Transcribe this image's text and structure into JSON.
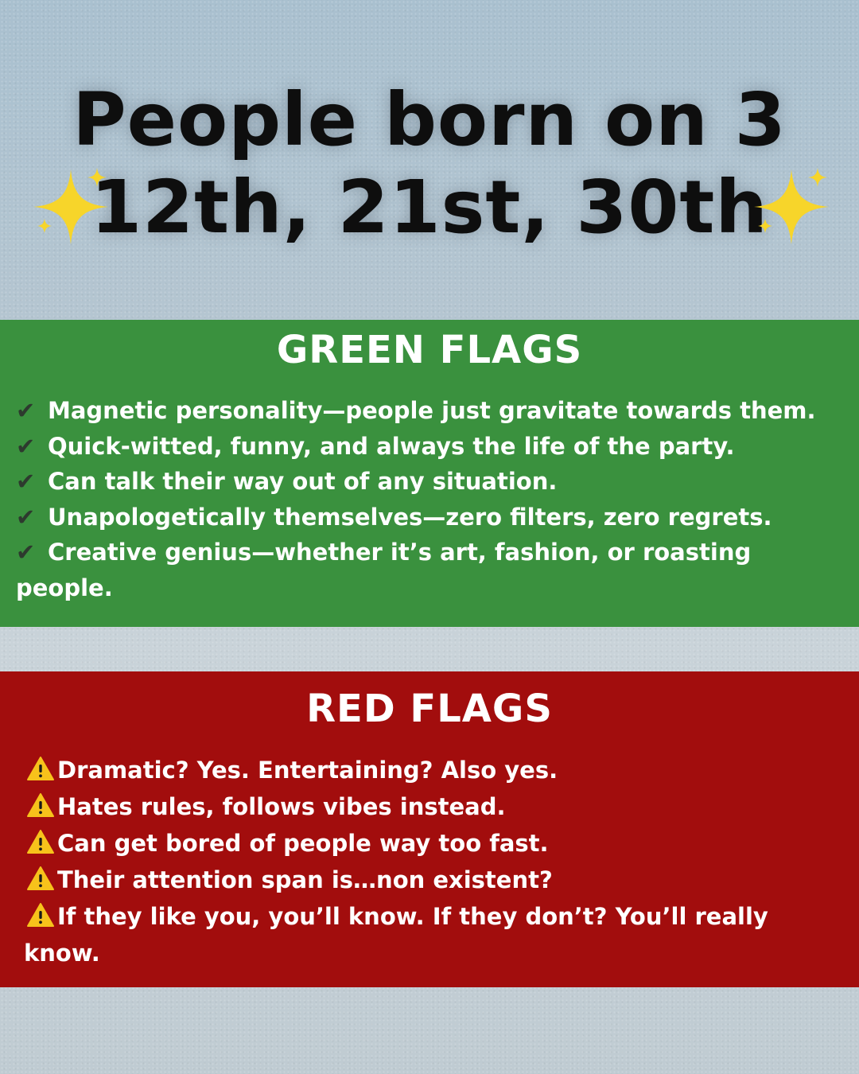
{
  "title": {
    "line1": "People born on 3",
    "line2": "12th, 21st, 30th"
  },
  "decorations": {
    "sparkle_icon": "sparkles-icon",
    "sparkle_color": "#f7d52a"
  },
  "green_flags": {
    "heading": "GREEN FLAGS",
    "bullet": "✔",
    "color": "#3a913e",
    "items": [
      "Magnetic personality—people just gravitate towards them.",
      "Quick-witted, funny, and always the life of the party.",
      "Can talk their way out of any situation.",
      "Unapologetically themselves—zero filters, zero regrets.",
      "Creative genius—whether it’s art, fashion, or roasting people."
    ]
  },
  "red_flags": {
    "heading": "RED FLAGS",
    "bullet_icon": "warning-icon",
    "color": "#a20d0d",
    "items": [
      "Dramatic? Yes. Entertaining? Also yes.",
      "Hates rules, follows vibes instead.",
      "Can get bored of people way too fast.",
      "Their attention span is…non existent?",
      "If they like you, you’ll know. If they don’t? You’ll really know."
    ]
  }
}
